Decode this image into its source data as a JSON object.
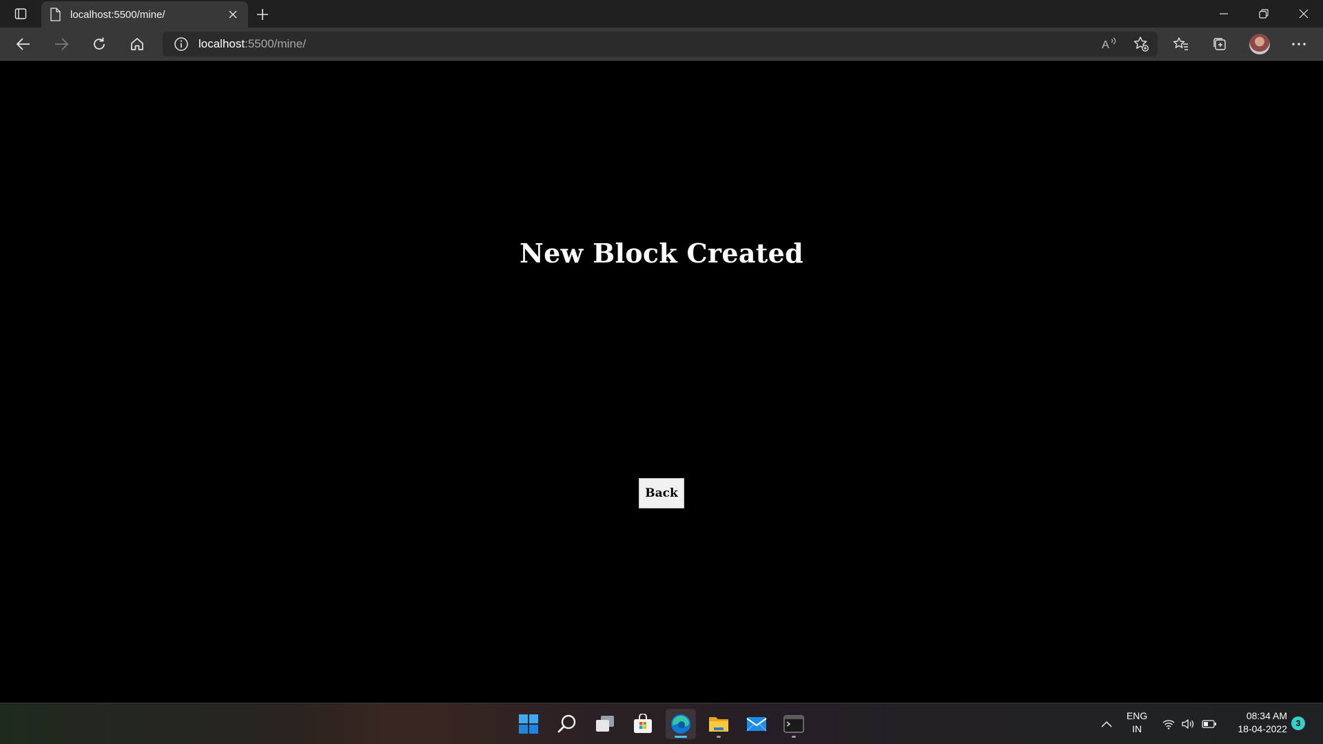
{
  "browser": {
    "tab": {
      "title": "localhost:5500/mine/"
    },
    "address": {
      "host": "localhost",
      "rest": ":5500/mine/"
    }
  },
  "page": {
    "heading": "New Block Created",
    "back_button": "Back"
  },
  "taskbar": {
    "language": {
      "line1": "ENG",
      "line2": "IN"
    },
    "clock": {
      "time": "08:34 AM",
      "date": "18-04-2022"
    },
    "notifications": "3",
    "apps": [
      "start-icon",
      "search-icon",
      "task-view-icon",
      "microsoft-store-icon",
      "edge-icon",
      "file-explorer-icon",
      "mail-icon",
      "terminal-icon"
    ]
  },
  "colors": {
    "page_background": "#000000",
    "heading_text": "#ffffff",
    "button_background": "#f0f0f0",
    "edge_accent": "#4cc2ff",
    "badge": "#35d0c8"
  }
}
